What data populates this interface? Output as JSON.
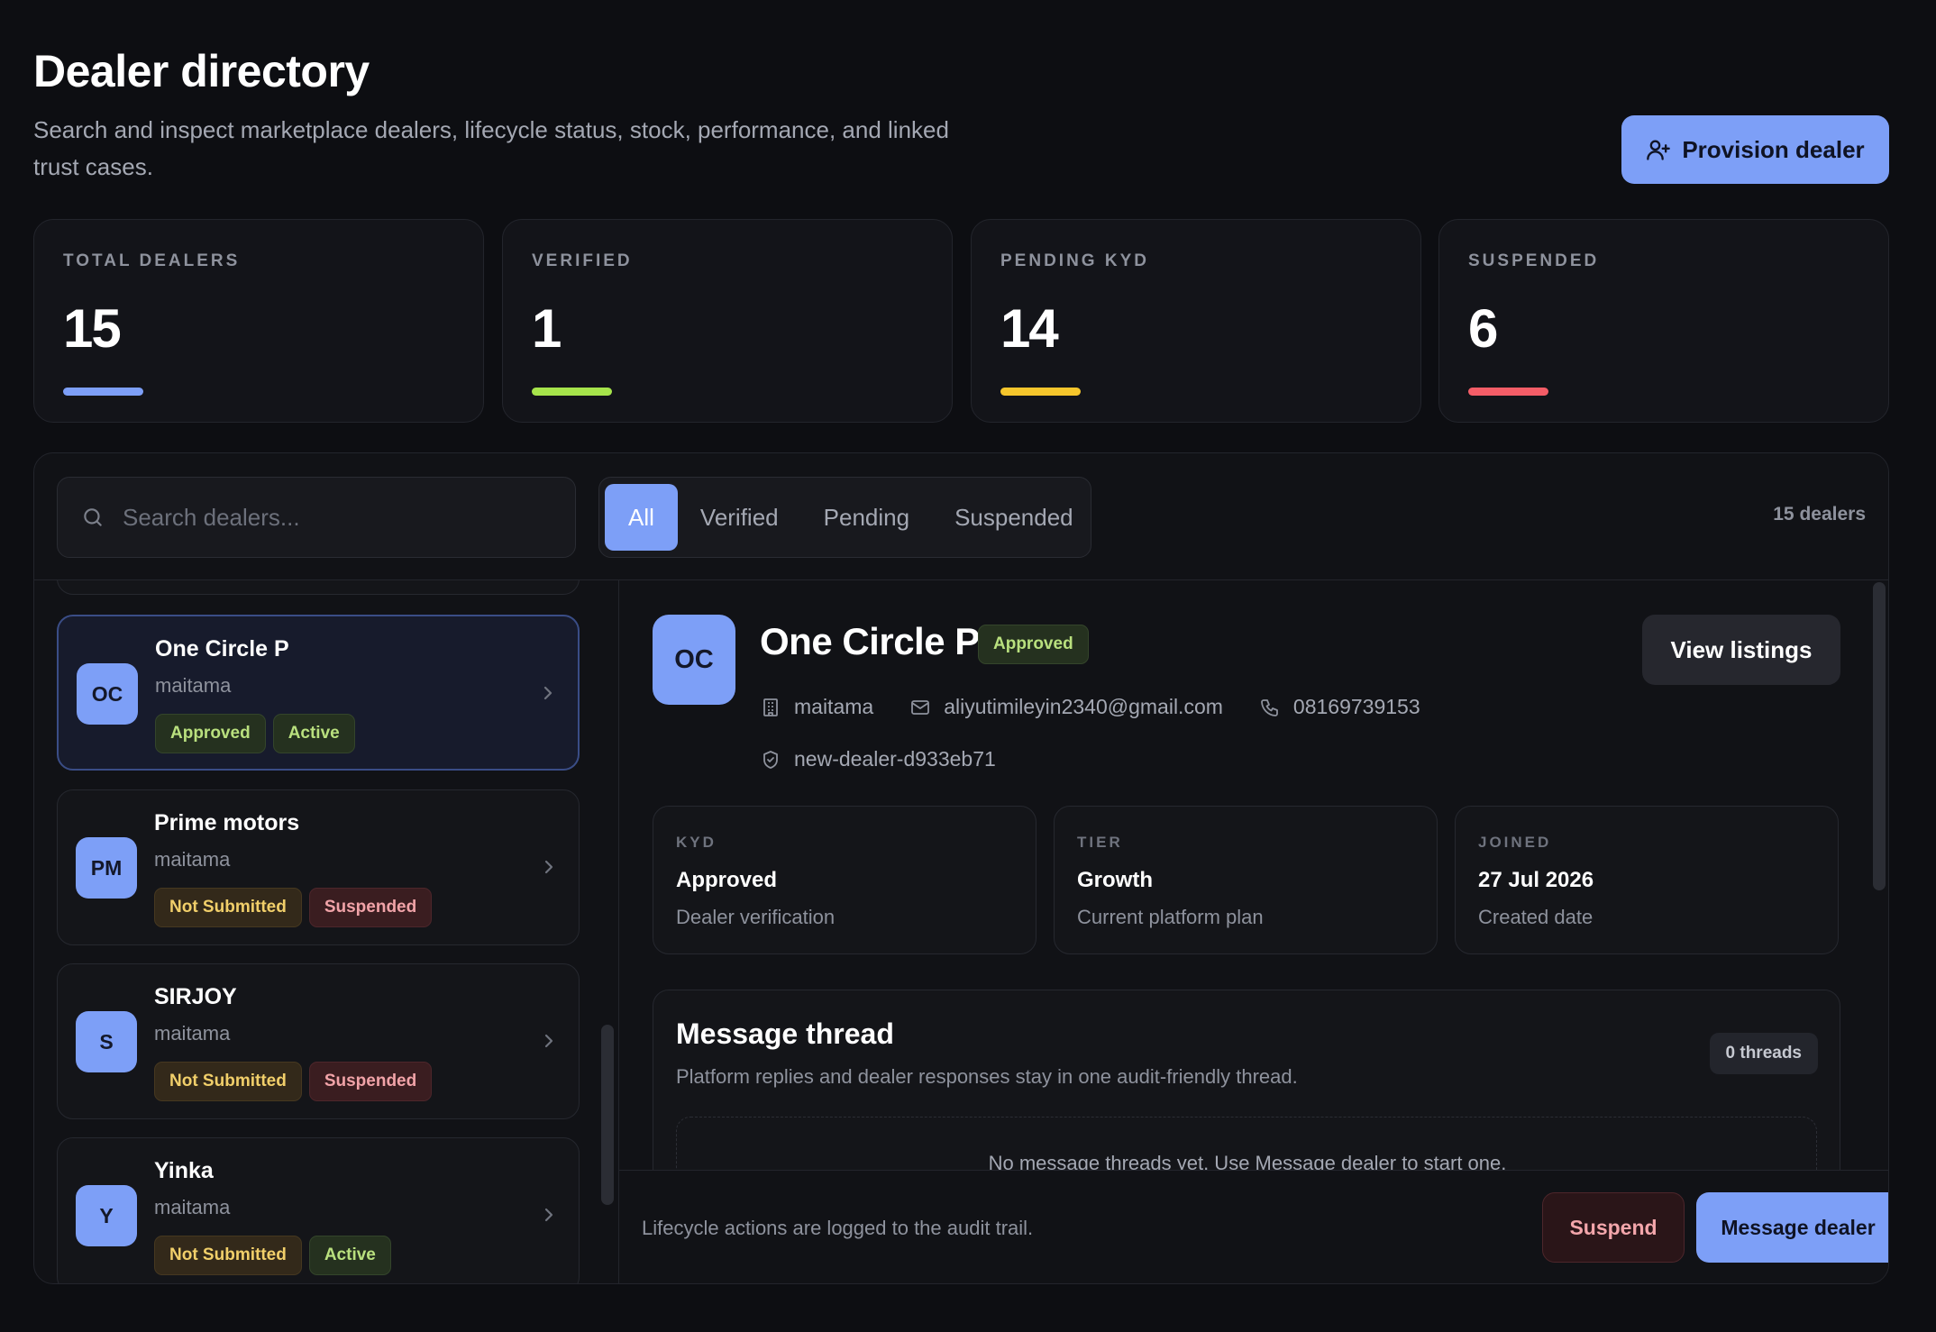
{
  "header": {
    "title": "Dealer directory",
    "subtitle": "Search and inspect marketplace dealers, lifecycle status, stock, performance, and linked trust cases.",
    "provision_label": "Provision dealer"
  },
  "stats": [
    {
      "label": "TOTAL DEALERS",
      "value": "15",
      "color": "#7d9ff7"
    },
    {
      "label": "VERIFIED",
      "value": "1",
      "color": "#a6e44b"
    },
    {
      "label": "PENDING KYD",
      "value": "14",
      "color": "#f5c62c"
    },
    {
      "label": "SUSPENDED",
      "value": "6",
      "color": "#f45d67"
    }
  ],
  "search": {
    "placeholder": "Search dealers..."
  },
  "filters": {
    "tabs": [
      "All",
      "Verified",
      "Pending",
      "Suspended"
    ],
    "selected": "All",
    "count_label": "15 dealers"
  },
  "dealers": [
    {
      "initials": "OC",
      "name": "One Circle P",
      "owner": "maitama",
      "badges": [
        "Approved",
        "Active"
      ],
      "selected": true
    },
    {
      "initials": "PM",
      "name": "Prime motors",
      "owner": "maitama",
      "badges": [
        "Not Submitted",
        "Suspended"
      ]
    },
    {
      "initials": "S",
      "name": "SIRJOY",
      "owner": "maitama",
      "badges": [
        "Not Submitted",
        "Suspended"
      ]
    },
    {
      "initials": "Y",
      "name": "Yinka",
      "owner": "maitama",
      "badges": [
        "Not Submitted",
        "Active"
      ]
    }
  ],
  "detail": {
    "initials": "OC",
    "name": "One Circle P",
    "status": "Approved",
    "view_listings_label": "View listings",
    "location": "maitama",
    "email": "aliyutimileyin2340@gmail.com",
    "phone": "08169739153",
    "slug": "new-dealer-d933eb71",
    "info": [
      {
        "label": "KYD",
        "value": "Approved",
        "sub": "Dealer verification"
      },
      {
        "label": "TIER",
        "value": "Growth",
        "sub": "Current platform plan"
      },
      {
        "label": "JOINED",
        "value": "27 Jul 2026",
        "sub": "Created date"
      }
    ],
    "thread": {
      "title": "Message thread",
      "subtitle": "Platform replies and dealer responses stay in one audit-friendly thread.",
      "count_label": "0 threads",
      "empty_text": "No message threads yet. Use Message dealer to start one."
    }
  },
  "footer": {
    "note": "Lifecycle actions are logged to the audit trail.",
    "suspend_label": "Suspend",
    "message_label": "Message dealer"
  }
}
